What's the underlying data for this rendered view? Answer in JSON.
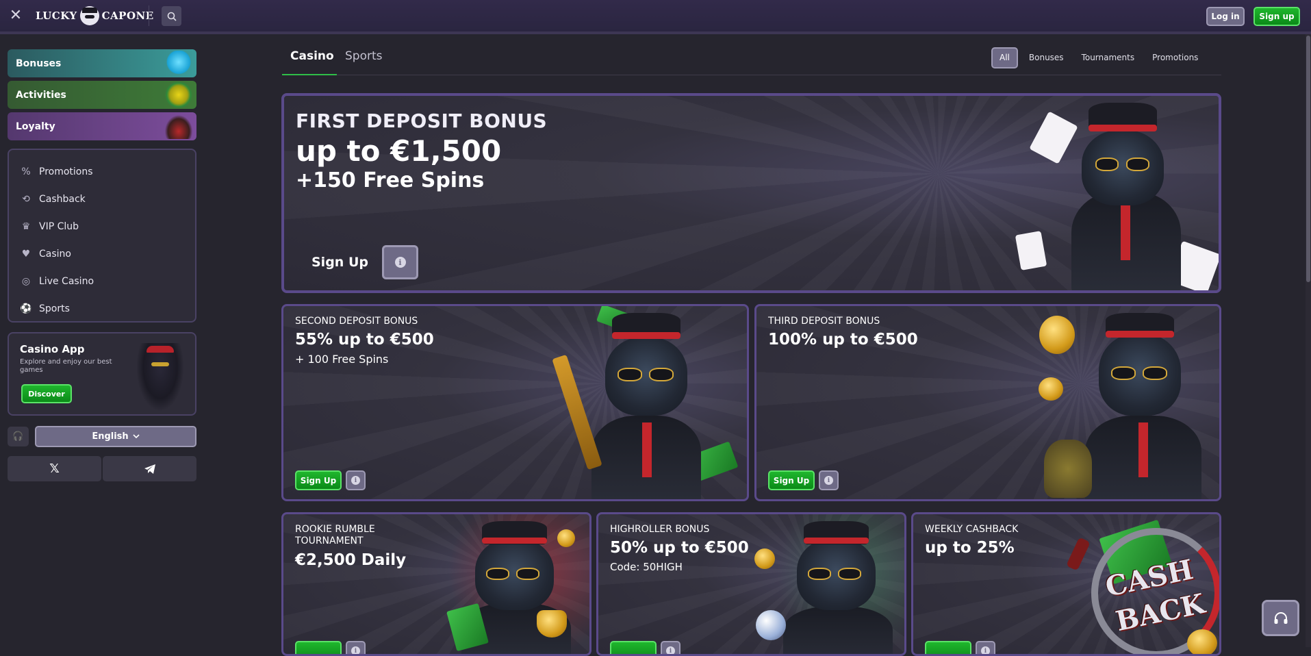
{
  "header": {
    "logo_left": "LUCKY",
    "logo_right": "CAPONE",
    "login_label": "Log in",
    "signup_label": "Sign up"
  },
  "sidebar": {
    "tiles": [
      {
        "label": "Bonuses"
      },
      {
        "label": "Activities"
      },
      {
        "label": "Loyalty"
      }
    ],
    "menu": [
      {
        "label": "Promotions",
        "icon": "percent-icon"
      },
      {
        "label": "Cashback",
        "icon": "cashback-icon"
      },
      {
        "label": "VIP Club",
        "icon": "crown-icon"
      },
      {
        "label": "Casino",
        "icon": "casino-icon"
      },
      {
        "label": "Live Casino",
        "icon": "live-casino-icon"
      },
      {
        "label": "Sports",
        "icon": "sports-ball-icon"
      }
    ],
    "app": {
      "title": "Casino App",
      "description": "Explore and enjoy our best games",
      "button": "Discover"
    },
    "language": "English"
  },
  "main": {
    "tabs": [
      {
        "label": "Casino",
        "active": true
      },
      {
        "label": "Sports",
        "active": false
      }
    ],
    "filters": [
      {
        "label": "All",
        "active": true
      },
      {
        "label": "Bonuses",
        "active": false
      },
      {
        "label": "Tournaments",
        "active": false
      },
      {
        "label": "Promotions",
        "active": false
      }
    ],
    "cards": {
      "first": {
        "title": "FIRST DEPOSIT BONUS",
        "amount": "up to €1,500",
        "extra": "+150 Free Spins",
        "cta": "Sign Up"
      },
      "second": {
        "title": "SECOND DEPOSIT BONUS",
        "amount": "55% up to €500",
        "extra": "+ 100 Free Spins",
        "cta": "Sign Up"
      },
      "third": {
        "title": "THIRD DEPOSIT BONUS",
        "amount": "100% up to €500",
        "cta": "Sign Up"
      },
      "rookie": {
        "title": "ROOKIE RUMBLE TOURNAMENT",
        "amount": "€2,500 Daily"
      },
      "highroller": {
        "title": "HIGHROLLER BONUS",
        "amount": "50% up to €500",
        "code": "Code: 50HIGH"
      },
      "cashback": {
        "title": "WEEKLY CASHBACK",
        "amount": "up to 25%",
        "art_line1": "CASH",
        "art_line2": "BACK"
      }
    }
  },
  "colors": {
    "accent_green": "#1fb62d",
    "card_border": "#5a4a8a",
    "background": "#26252e"
  }
}
